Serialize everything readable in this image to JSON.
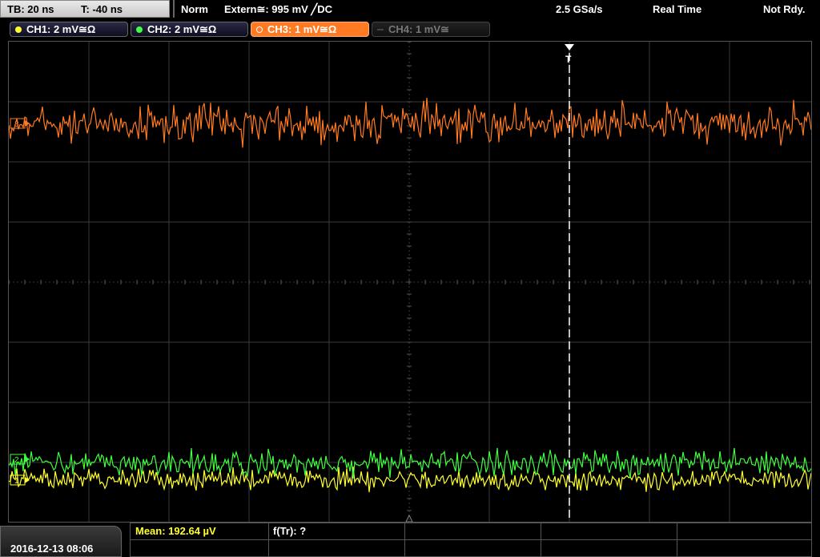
{
  "status": {
    "timebase": "TB: 20 ns",
    "trigger_time": "T: -40 ns",
    "mode": "Norm",
    "trigger_source": "Extern≅: 995 mV ╱DC",
    "sample_rate": "2.5 GSa/s",
    "acquisition": "Real Time",
    "state": "Not Rdy."
  },
  "channels": [
    {
      "label": "CH1: 2 mV≅Ω",
      "color": "#ffff30",
      "active": false,
      "enabled": true
    },
    {
      "label": "CH2: 2 mV≅Ω",
      "color": "#40ff40",
      "active": false,
      "enabled": true
    },
    {
      "label": "CH3: 1 mV≅Ω",
      "color": "#ff7a22",
      "active": true,
      "enabled": true
    },
    {
      "label": "CH4: 1 mV≅",
      "color": "#777777",
      "active": false,
      "enabled": false
    }
  ],
  "markers": {
    "trigger_marker": "T",
    "ch3_marker": "3",
    "ch2_marker": "2",
    "ch1_marker": "1"
  },
  "footer": {
    "datetime": "2016-12-13 08:06",
    "measurement_1": "Mean: 192.64 µV",
    "measurement_2": "f(Tr): ?"
  },
  "colors": {
    "grid": "#3a3a3a",
    "ch1": "#ffff30",
    "ch2": "#40ff40",
    "ch3": "#ff7a22",
    "trigger_line": "#ffffff",
    "measurement_text": "#ffff30"
  },
  "traces": {
    "ch3_noise_amplitude_divs": 0.45,
    "ch2_noise_amplitude_divs": 0.3,
    "ch1_noise_amplitude_divs": 0.25
  }
}
